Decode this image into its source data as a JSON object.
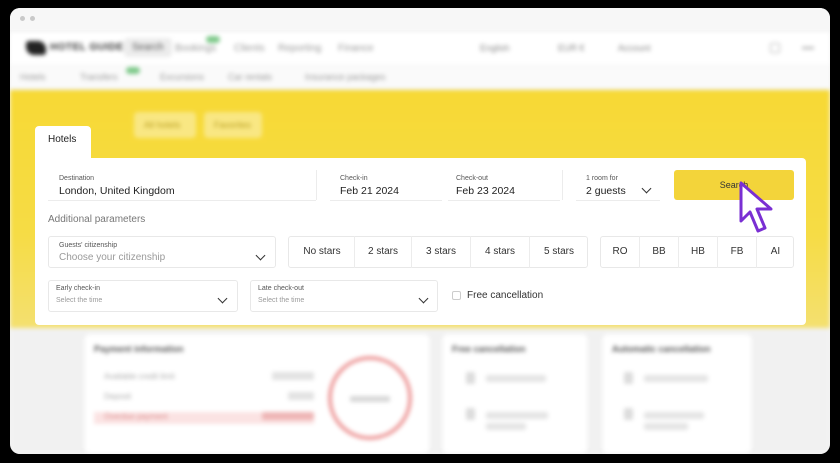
{
  "background_app": {
    "nav": {
      "logo": "HOTEL GUIDE",
      "items": [
        "Search",
        "Bookings",
        "Clients",
        "Reporting",
        "Finance"
      ],
      "right": [
        "English",
        "EUR €",
        "Account"
      ]
    },
    "subnav": [
      "Hotels",
      "Transfers",
      "Excursions",
      "Car rentals",
      "Insurance packages"
    ],
    "hero_pills": [
      "All hotels",
      "Favorites"
    ],
    "cards": {
      "payment_title": "Payment information",
      "payment_rows": [
        "Available credit limit",
        "Deposit",
        "Overdue payment"
      ],
      "card2_title": "Free cancellation",
      "card3_title": "Automatic cancellation"
    }
  },
  "tab": {
    "label": "Hotels"
  },
  "search": {
    "destination_label": "Destination",
    "destination_value": "London, United Kingdom",
    "checkin_label": "Check-in",
    "checkin_value": "Feb 21 2024",
    "checkout_label": "Check-out",
    "checkout_value": "Feb 23 2024",
    "rooms_label": "1 room for",
    "rooms_value": "2 guests",
    "search_button": "Search"
  },
  "params": {
    "title": "Additional parameters",
    "citizenship_label": "Guests' citizenship",
    "citizenship_placeholder": "Choose your citizenship",
    "stars": [
      "No stars",
      "2 stars",
      "3 stars",
      "4 stars",
      "5 stars"
    ],
    "meals": [
      "RO",
      "BB",
      "HB",
      "FB",
      "AI"
    ],
    "early_checkin_label": "Early check-in",
    "early_checkin_placeholder": "Select the time",
    "late_checkout_label": "Late check-out",
    "late_checkout_placeholder": "Select the time",
    "free_cancellation": "Free cancellation"
  },
  "colors": {
    "accent_yellow": "#f3d43a",
    "hero_yellow": "#f7d935"
  }
}
